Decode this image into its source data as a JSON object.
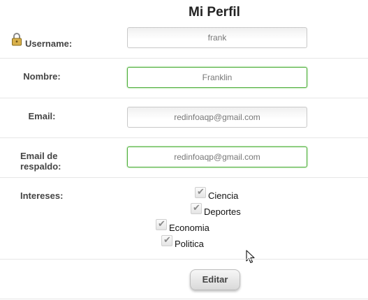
{
  "page": {
    "title": "Mi Perfil"
  },
  "fields": {
    "username": {
      "label": "Username:",
      "value": "frank"
    },
    "nombre": {
      "label": "Nombre:",
      "value": "Franklin"
    },
    "email": {
      "label": "Email:",
      "value": "redinfoaqp@gmail.com"
    },
    "email_respaldo": {
      "label_line1": "Email de",
      "label_line2": "respaldo:",
      "value": "redinfoaqp@gmail.com"
    }
  },
  "intereses": {
    "label": "Intereses:",
    "items": [
      {
        "label": "Ciencia",
        "checked": true
      },
      {
        "label": "Deportes",
        "checked": true
      },
      {
        "label": "Economia",
        "checked": true
      },
      {
        "label": "Politica",
        "checked": true
      }
    ]
  },
  "actions": {
    "edit_label": "Editar"
  },
  "icons": {
    "lock": "lock-icon",
    "check": "checkmark-icon",
    "cursor": "mouse-pointer-icon"
  }
}
